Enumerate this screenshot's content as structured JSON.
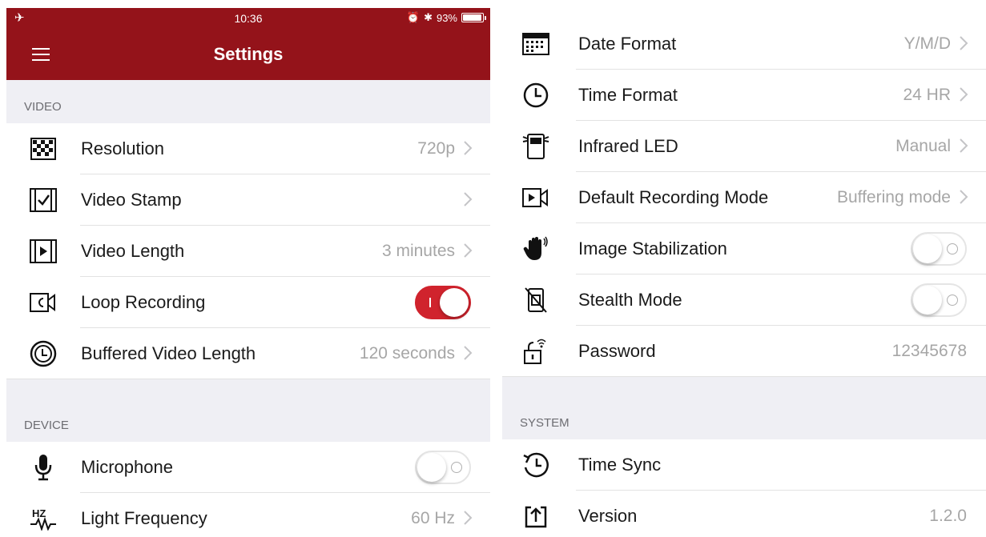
{
  "status_bar": {
    "time": "10:36",
    "battery": "93%"
  },
  "nav": {
    "title": "Settings"
  },
  "sections": {
    "video": "VIDEO",
    "device": "DEVICE",
    "system": "SYSTEM"
  },
  "video": {
    "resolution": {
      "label": "Resolution",
      "value": "720p"
    },
    "video_stamp": {
      "label": "Video Stamp",
      "value": ""
    },
    "video_length": {
      "label": "Video Length",
      "value": "3 minutes"
    },
    "loop_recording": {
      "label": "Loop Recording",
      "on": true
    },
    "buffered_length": {
      "label": "Buffered Video Length",
      "value": "120 seconds"
    }
  },
  "device": {
    "microphone": {
      "label": "Microphone",
      "on": false
    },
    "light_frequency": {
      "label": "Light Frequency",
      "value": "60 Hz"
    },
    "date_format": {
      "label": "Date Format",
      "value": "Y/M/D"
    },
    "time_format": {
      "label": "Time Format",
      "value": "24 HR"
    },
    "infrared_led": {
      "label": "Infrared LED",
      "value": "Manual"
    },
    "default_recording_mode": {
      "label": "Default Recording Mode",
      "value": "Buffering mode"
    },
    "image_stabilization": {
      "label": "Image Stabilization",
      "on": false
    },
    "stealth_mode": {
      "label": "Stealth Mode",
      "on": false
    },
    "password": {
      "label": "Password",
      "value": "12345678"
    }
  },
  "system": {
    "time_sync": {
      "label": "Time Sync"
    },
    "version": {
      "label": "Version",
      "value": "1.2.0"
    }
  },
  "colors": {
    "brand": "#94131a",
    "toggle_on": "#d0232d",
    "section_bg": "#efeff4"
  }
}
